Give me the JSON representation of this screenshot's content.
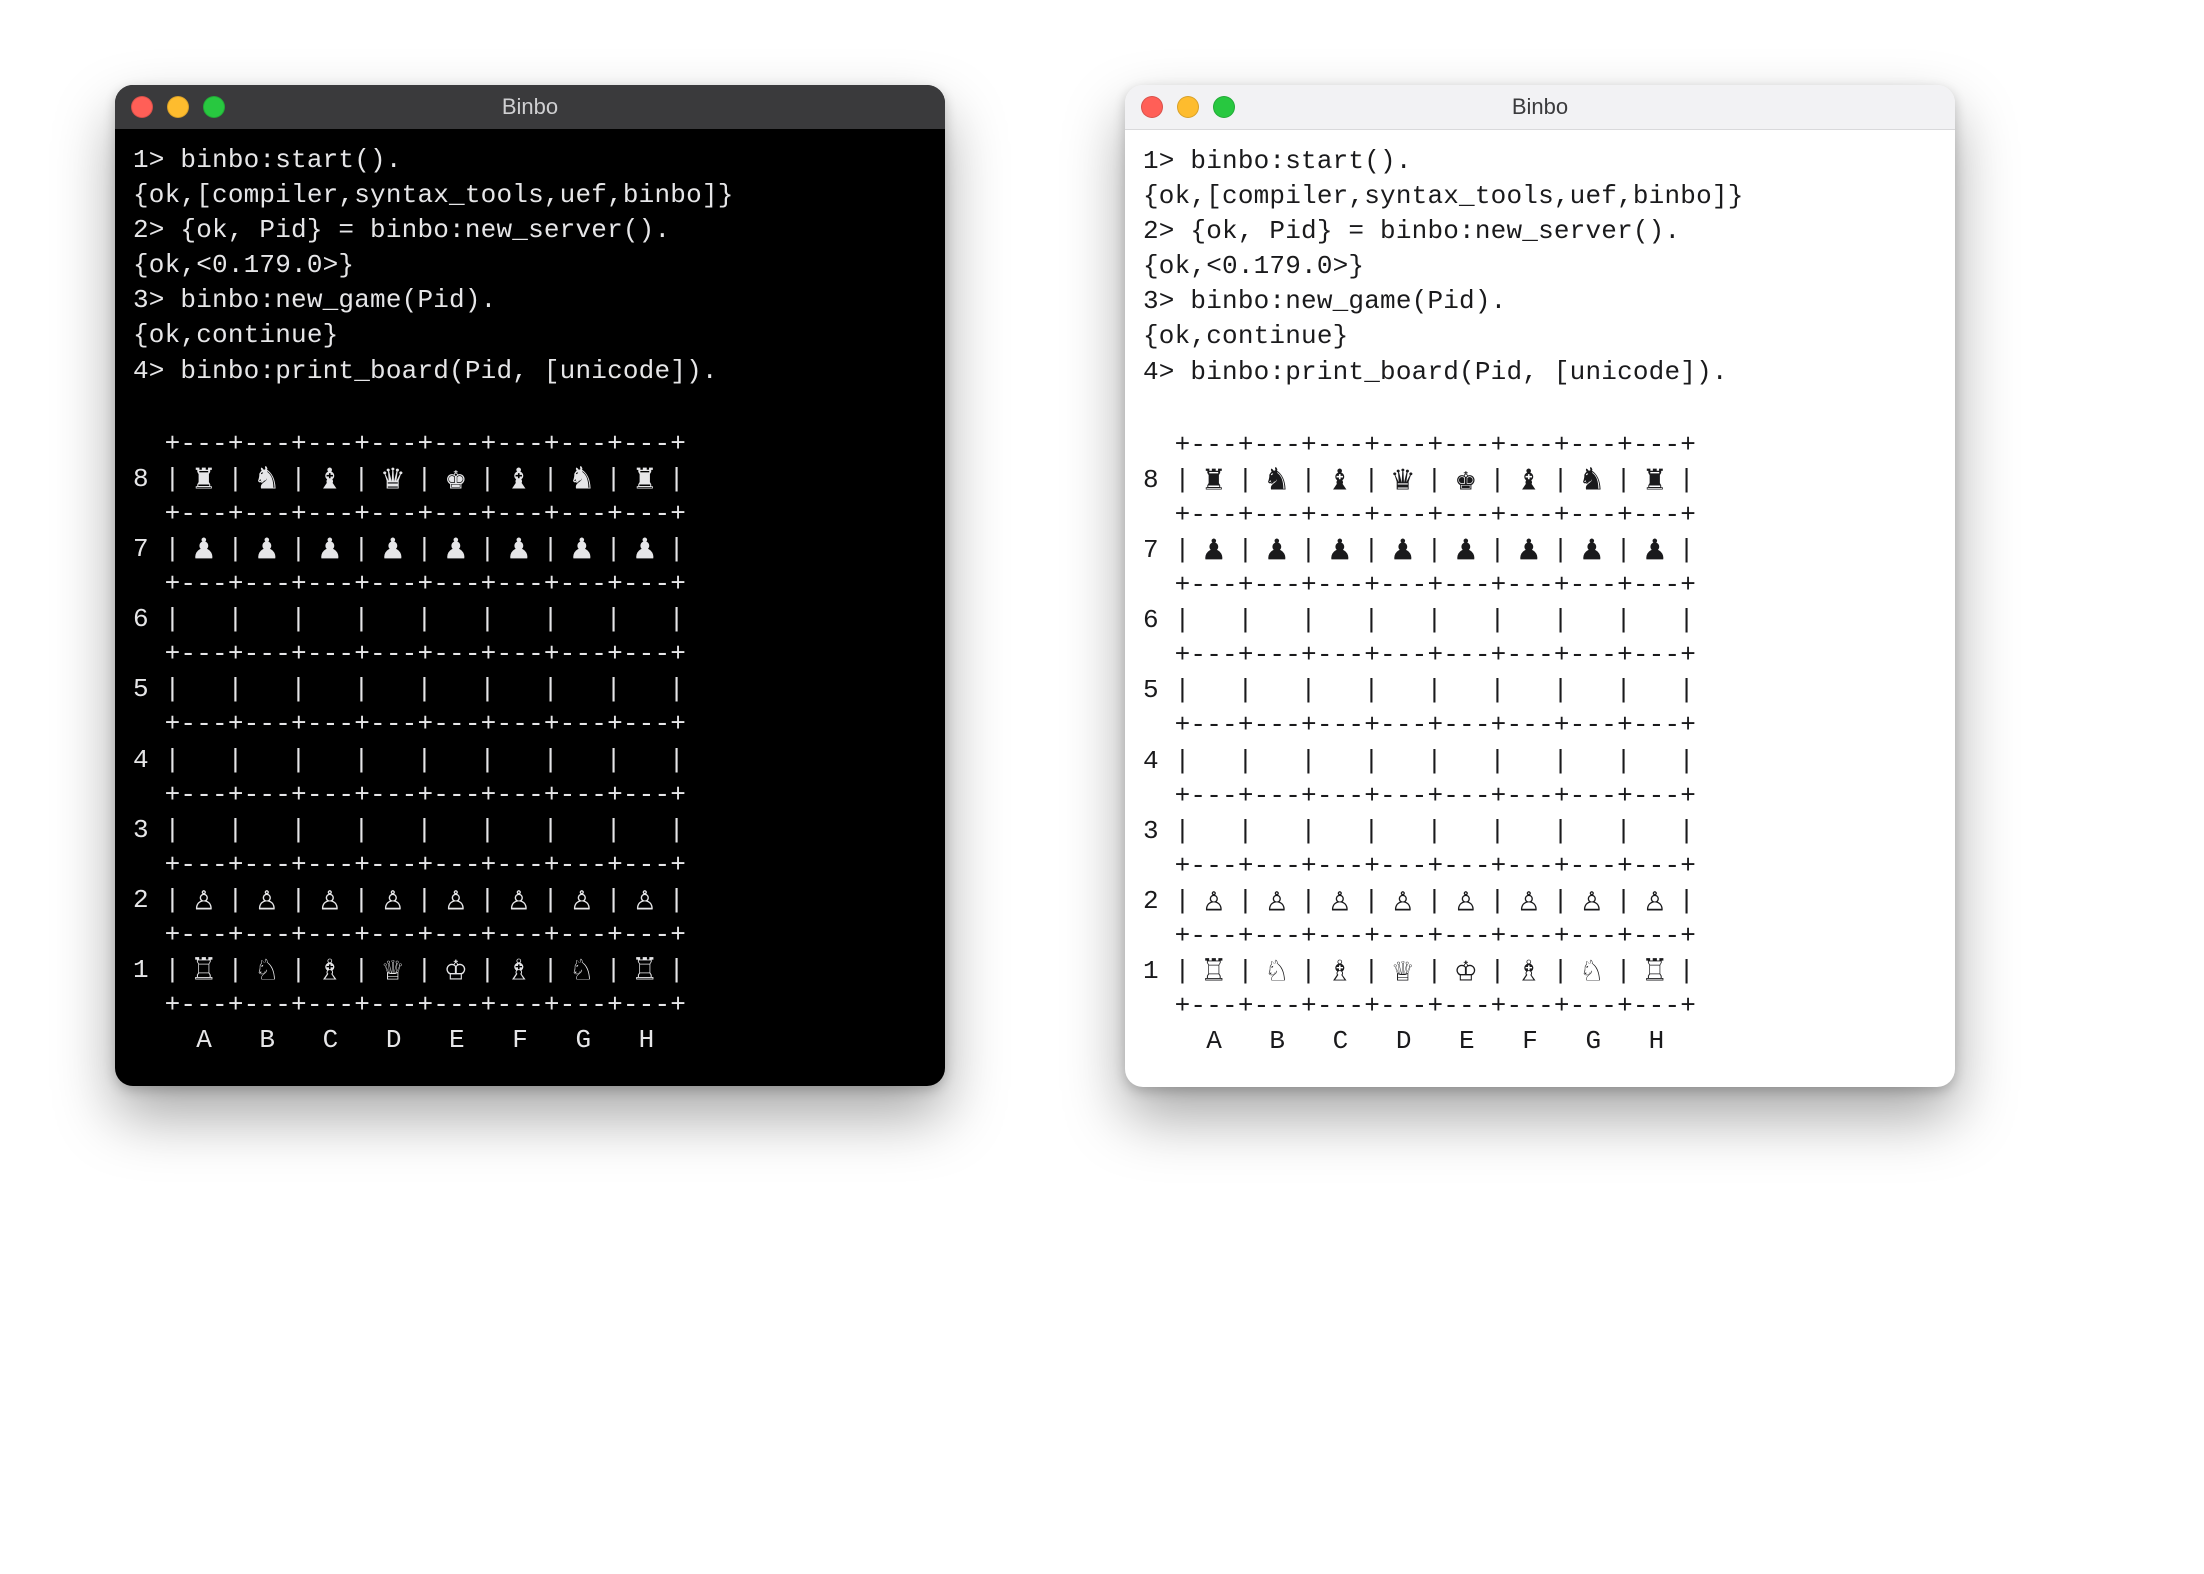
{
  "windowTitle": "Binbo",
  "terminalLines": [
    "1> binbo:start().",
    "{ok,[compiler,syntax_tools,uef,binbo]}",
    "2> {ok, Pid} = binbo:new_server().",
    "{ok,<0.179.0>}",
    "3> binbo:new_game(Pid).",
    "{ok,continue}",
    "4> binbo:print_board(Pid, [unicode])."
  ],
  "board": {
    "divider": "  +---+---+---+---+---+---+---+---+",
    "files": "    A   B   C   D   E   F   G   H  ",
    "ranks": [
      {
        "rank": "8",
        "pieces": [
          "♜",
          "♞",
          "♝",
          "♛",
          "♚",
          "♝",
          "♞",
          "♜"
        ]
      },
      {
        "rank": "7",
        "pieces": [
          "♟",
          "♟",
          "♟",
          "♟",
          "♟",
          "♟",
          "♟",
          "♟"
        ]
      },
      {
        "rank": "6",
        "pieces": [
          " ",
          " ",
          " ",
          " ",
          " ",
          " ",
          " ",
          " "
        ]
      },
      {
        "rank": "5",
        "pieces": [
          " ",
          " ",
          " ",
          " ",
          " ",
          " ",
          " ",
          " "
        ]
      },
      {
        "rank": "4",
        "pieces": [
          " ",
          " ",
          " ",
          " ",
          " ",
          " ",
          " ",
          " "
        ]
      },
      {
        "rank": "3",
        "pieces": [
          " ",
          " ",
          " ",
          " ",
          " ",
          " ",
          " ",
          " "
        ]
      },
      {
        "rank": "2",
        "pieces": [
          "♙",
          "♙",
          "♙",
          "♙",
          "♙",
          "♙",
          "♙",
          "♙"
        ]
      },
      {
        "rank": "1",
        "pieces": [
          "♖",
          "♘",
          "♗",
          "♕",
          "♔",
          "♗",
          "♘",
          "♖"
        ]
      }
    ]
  }
}
